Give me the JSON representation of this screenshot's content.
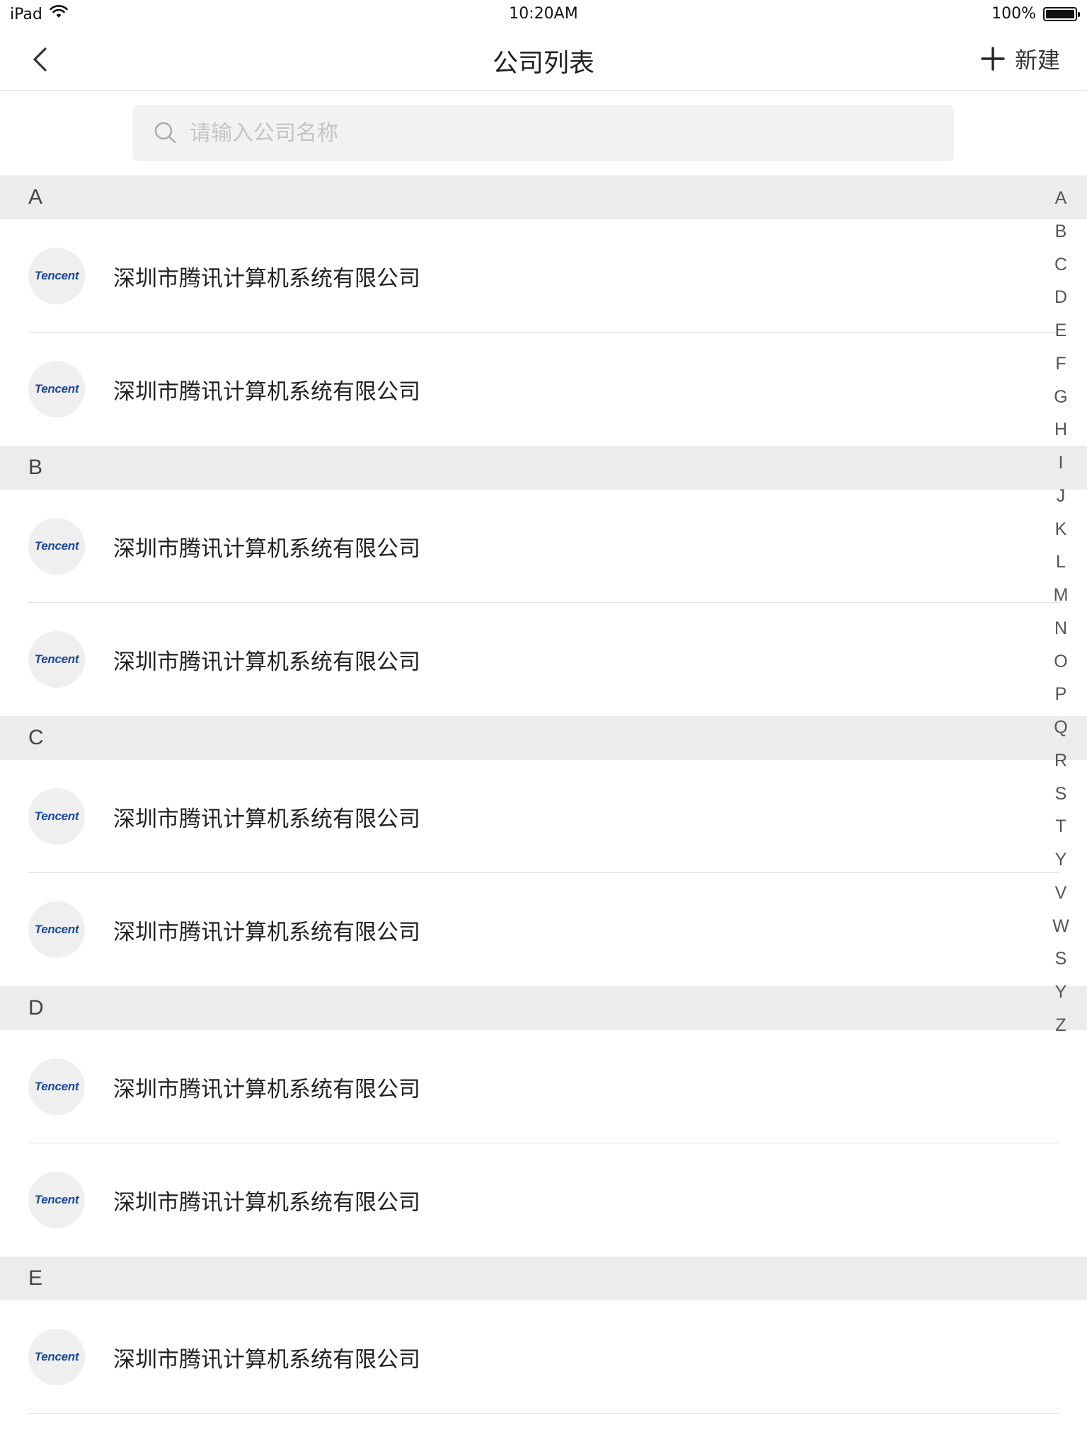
{
  "status_bar": {
    "device": "iPad",
    "time": "10:20AM",
    "battery": "100%",
    "battery_level": 1.0
  },
  "nav": {
    "title": "公司列表",
    "new_label": "新建"
  },
  "search": {
    "placeholder": "请输入公司名称"
  },
  "sections": [
    {
      "letter": "A",
      "items": [
        {
          "name": "深圳市腾讯计算机系统有限公司",
          "logo": "Tencent"
        },
        {
          "name": "深圳市腾讯计算机系统有限公司",
          "logo": "Tencent"
        }
      ]
    },
    {
      "letter": "B",
      "items": [
        {
          "name": "深圳市腾讯计算机系统有限公司",
          "logo": "Tencent"
        },
        {
          "name": "深圳市腾讯计算机系统有限公司",
          "logo": "Tencent"
        }
      ]
    },
    {
      "letter": "C",
      "items": [
        {
          "name": "深圳市腾讯计算机系统有限公司",
          "logo": "Tencent"
        },
        {
          "name": "深圳市腾讯计算机系统有限公司",
          "logo": "Tencent"
        }
      ]
    },
    {
      "letter": "D",
      "items": [
        {
          "name": "深圳市腾讯计算机系统有限公司",
          "logo": "Tencent"
        },
        {
          "name": "深圳市腾讯计算机系统有限公司",
          "logo": "Tencent"
        }
      ]
    },
    {
      "letter": "E",
      "items": [
        {
          "name": "深圳市腾讯计算机系统有限公司",
          "logo": "Tencent"
        }
      ]
    }
  ],
  "index_letters": [
    "A",
    "B",
    "C",
    "D",
    "E",
    "F",
    "G",
    "H",
    "I",
    "J",
    "K",
    "L",
    "M",
    "N",
    "O",
    "P",
    "Q",
    "R",
    "S",
    "T",
    "Y",
    "V",
    "W",
    "S",
    "Y",
    "Z"
  ]
}
